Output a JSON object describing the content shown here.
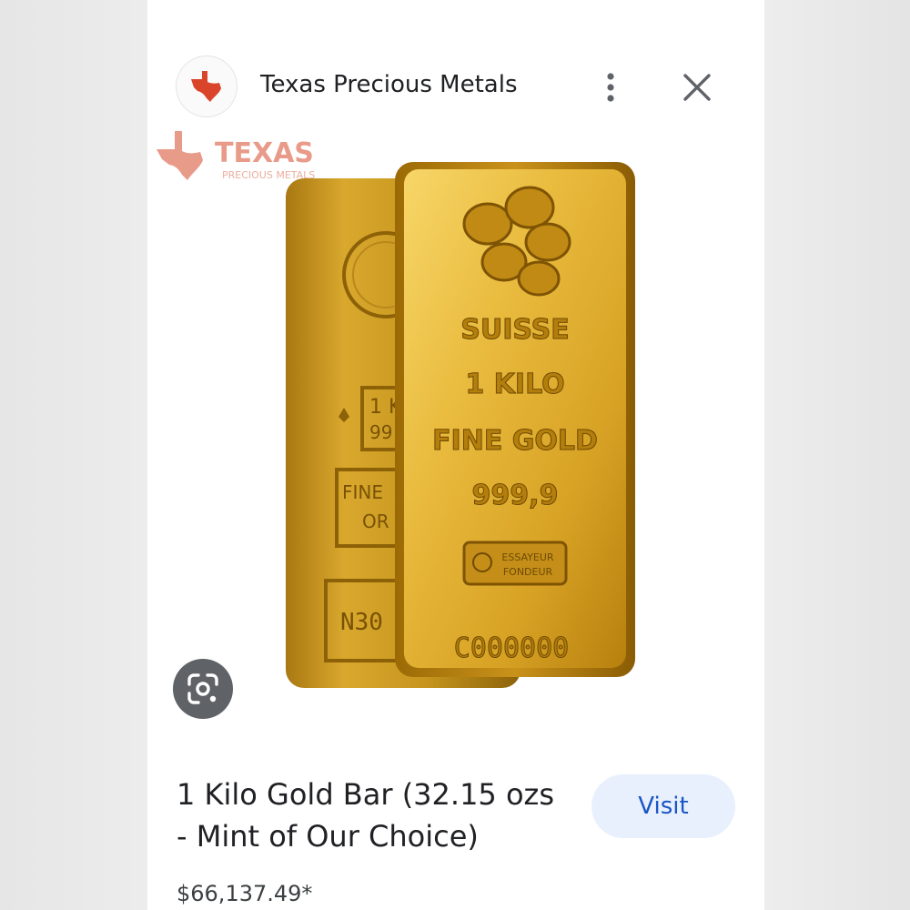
{
  "header": {
    "site_name": "Texas Precious Metals",
    "icons": {
      "site": "texas-state-icon",
      "more": "more-vert-icon",
      "close": "close-icon"
    }
  },
  "image": {
    "watermark": {
      "brand": "TEXAS",
      "sub": "PRECIOUS METALS"
    },
    "front_bar": {
      "lines": [
        "SUISSE",
        "1 KILO",
        "FINE GOLD",
        "999,9"
      ],
      "stamp_lines": [
        "ESSAYEUR",
        "FONDEUR"
      ],
      "serial": "C000000"
    },
    "back_bar": {
      "partial_lines": [
        "1 K",
        "99"
      ],
      "box_lines": [
        "FINE",
        "OR"
      ],
      "serial": "N30"
    },
    "lens_icon": "google-lens-icon"
  },
  "product": {
    "title_line1": "1 Kilo Gold Bar (32.15 ozs",
    "title_line2": "- Mint of Our Choice)",
    "price": "$66,137.49*",
    "visit_label": "Visit"
  },
  "colors": {
    "accent": "#1a56c4",
    "button_bg": "#e8f0fe",
    "texas_red": "#d9442b",
    "gold": "#e2b63a"
  }
}
